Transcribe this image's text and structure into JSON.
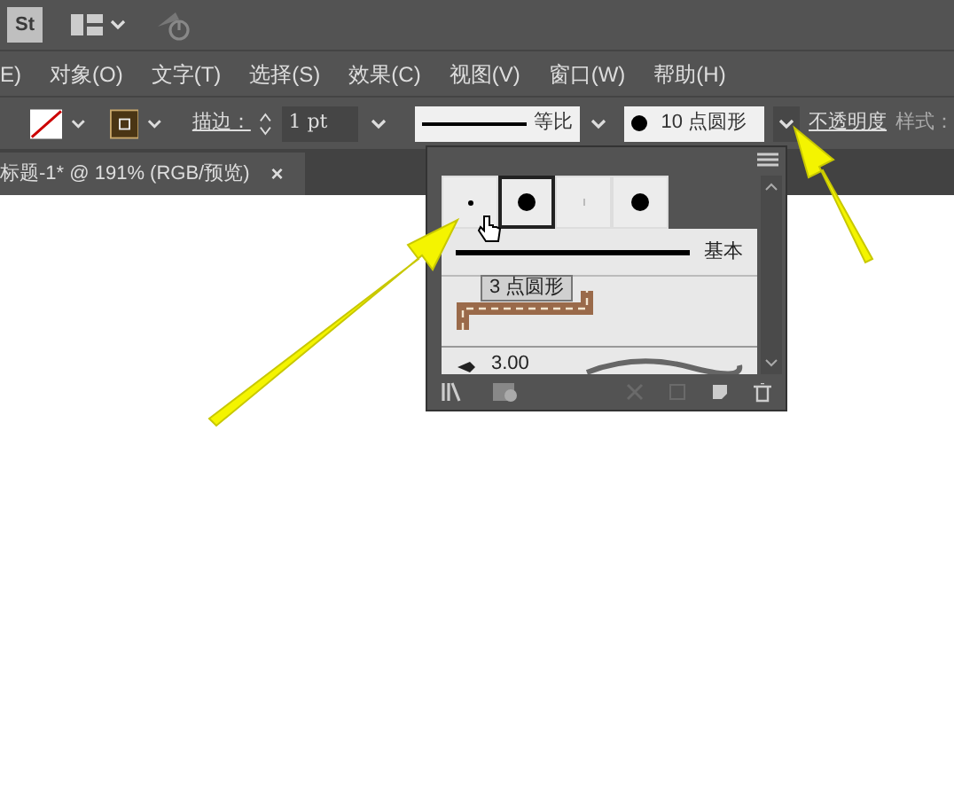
{
  "app_bar": {
    "logo": "St"
  },
  "menu": [
    "E)",
    "对象(O)",
    "文字(T)",
    "选择(S)",
    "效果(C)",
    "视图(V)",
    "窗口(W)",
    "帮助(H)"
  ],
  "control_bar": {
    "stroke_label": "描边：",
    "stroke_weight": "1 pt",
    "profile": "等比",
    "brush": "10 点圆形",
    "opacity": "不透明度",
    "style": "样式："
  },
  "document_tab": {
    "title": "标题-1* @ 191% (RGB/预览)",
    "close": "×"
  },
  "brush_panel": {
    "swatches": [
      {
        "kind": "small",
        "selected": false
      },
      {
        "kind": "large",
        "selected": true
      },
      {
        "kind": "faint",
        "selected": false
      },
      {
        "kind": "large",
        "selected": false
      }
    ],
    "tooltip": "3 点圆形",
    "rows": [
      {
        "kind": "line",
        "label": "基本"
      },
      {
        "kind": "pattern"
      },
      {
        "kind": "wave",
        "label": "3.00"
      }
    ]
  }
}
